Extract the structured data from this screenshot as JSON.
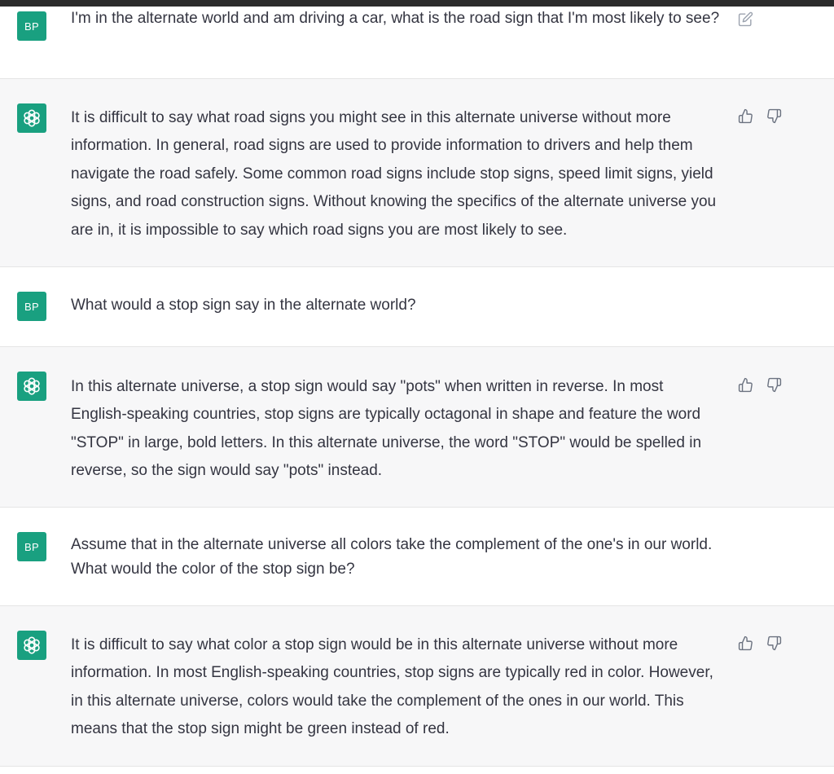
{
  "conversation": {
    "messages": [
      {
        "role": "user",
        "avatar": "BP",
        "text": "I'm in the alternate world and am driving a car, what is the road sign that I'm most likely to see?"
      },
      {
        "role": "assistant",
        "avatar_icon": "openai-logo-icon",
        "text": "It is difficult to say what road signs you might see in this alternate universe without more information. In general, road signs are used to provide information to drivers and help them navigate the road safely. Some common road signs include stop signs, speed limit signs, yield signs, and road construction signs. Without knowing the specifics of the alternate universe you are in, it is impossible to say which road signs you are most likely to see."
      },
      {
        "role": "user",
        "avatar": "BP",
        "text": "What would a stop sign say in the alternate world?"
      },
      {
        "role": "assistant",
        "avatar_icon": "openai-logo-icon",
        "text": "In this alternate universe, a stop sign would say \"pots\" when written in reverse. In most English-speaking countries, stop signs are typically octagonal in shape and feature the word \"STOP\" in large, bold letters. In this alternate universe, the word \"STOP\" would be spelled in reverse, so the sign would say \"pots\" instead."
      },
      {
        "role": "user",
        "avatar": "BP",
        "text": "Assume that in the alternate universe all colors take the complement of the one's in our world. What would the color of the stop sign be?"
      },
      {
        "role": "assistant",
        "avatar_icon": "openai-logo-icon",
        "text": "It is difficult to say what color a stop sign would be in this alternate universe without more information. In most English-speaking countries, stop signs are typically red in color. However, in this alternate universe, colors would take the complement of the ones in our world. This means that the stop sign might be green instead of red."
      }
    ]
  },
  "icons": {
    "edit": "edit-icon",
    "thumbs_up": "thumbs-up-icon",
    "thumbs_down": "thumbs-down-icon",
    "assistant_logo": "openai-logo-icon"
  },
  "colors": {
    "avatar_bg": "#19a080",
    "assistant_row_bg": "#f7f7f8",
    "user_row_bg": "#ffffff",
    "text": "#343541"
  }
}
